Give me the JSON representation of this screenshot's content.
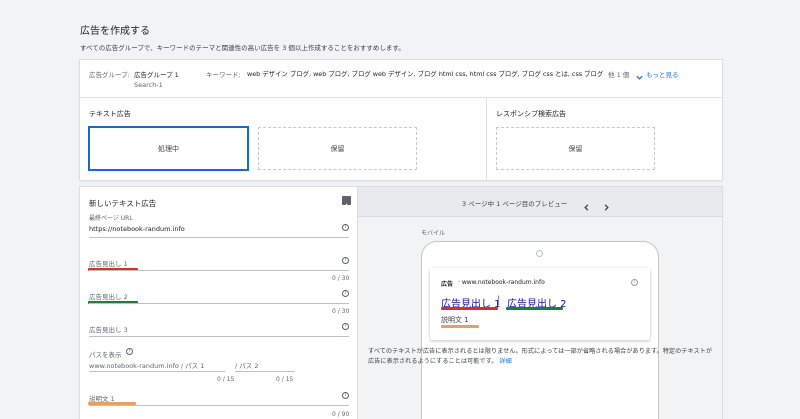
{
  "page": {
    "title": "広告を作成する",
    "subtitle": "すべての広告グループで、キーワードのテーマと関連性の高い広告を 3 個以上作成することをおすすめします。"
  },
  "ad_group": {
    "label": "広告グループ:",
    "name": "広告グループ 1",
    "campaign": "Search-1",
    "keywords_label": "キーワード:",
    "keywords": "web デザイン ブログ, web ブログ, ブログ web デザイン, ブログ html css, html css ブログ, ブログ css とは, css ブログ",
    "others": "他 1 個",
    "more_link": "もっと見る"
  },
  "text_ads": {
    "title": "テキスト広告",
    "processing": "処理中",
    "pending": "保留"
  },
  "responsive_ads": {
    "title": "レスポンシブ検索広告",
    "pending": "保留"
  },
  "form": {
    "title": "新しいテキスト広告",
    "final_url_label": "最終ページ URL",
    "final_url_value": "https://notebook-randum.info",
    "headline1": "広告見出し 1",
    "headline2": "広告見出し 2",
    "headline3": "広告見出し 3",
    "counter": "0 / 30",
    "path_label": "パスを表示",
    "path_domain": "www.notebook-randum.info / パス 1",
    "path2": "/ パス 2",
    "path_counter1": "0 / 15",
    "path_counter2": "0 / 15",
    "description1": "説明文 1",
    "desc_counter": "0 / 90"
  },
  "preview": {
    "nav_text": "3 ページ中 1 ページ目のプレビュー",
    "mobile_label": "モバイル",
    "ad_badge": "広告",
    "ad_url": "· www.notebook-randum.info",
    "headline1": "広告見出し 1",
    "separator": "|",
    "headline2": "広告見出し 2",
    "description": "説明文 1",
    "note": "すべてのテキストが広告に表示されるとは限りません。形式によっては一部が省略される場合があります。特定のテキストが広告に表示されるようにすることは可能です。",
    "details_link": "詳細"
  },
  "colors": {
    "red_mark": "#d93025",
    "green_mark": "#188038",
    "orange_mark": "#e8a060",
    "link_blue": "#1a73e8"
  }
}
